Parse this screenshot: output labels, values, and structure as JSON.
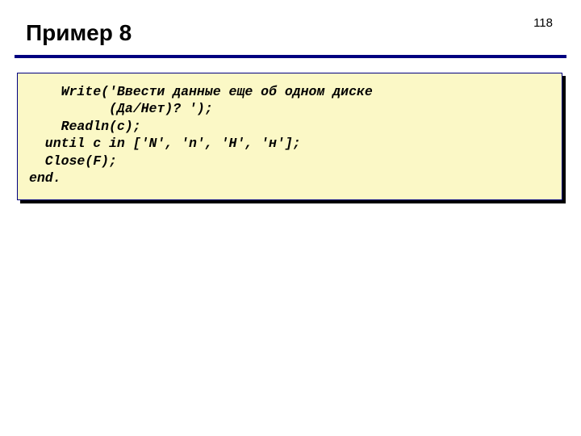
{
  "page_number": "118",
  "heading": "Пример 8",
  "code": {
    "line1": "    Write('Ввести данные еще об одном диске",
    "line2": "          (Да/Нет)? ');",
    "line3": "    Readln(c);",
    "line4": "  until c in ['N', 'n', 'Н', 'н'];",
    "line5": "  Close(F);",
    "line6": "end."
  }
}
